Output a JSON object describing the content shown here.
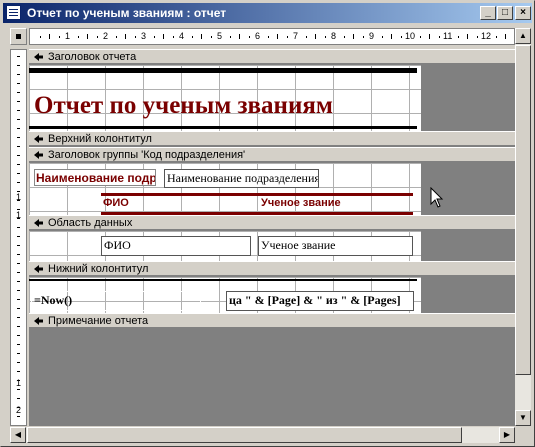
{
  "window": {
    "title": "Отчет по ученым званиям : отчет",
    "buttons": {
      "minimize": "_",
      "maximize": "□",
      "close": "×"
    }
  },
  "ruler": {
    "h_numbers": [
      "1",
      "2",
      "3",
      "4",
      "5",
      "6",
      "7",
      "8",
      "9",
      "10",
      "11",
      "12"
    ],
    "v_numbers": [
      "1",
      "1",
      "1",
      "2"
    ]
  },
  "sections": {
    "report_header": "Заголовок отчета",
    "page_header": "Верхний колонтитул",
    "group_header": "Заголовок группы 'Код подразделения'",
    "detail": "Область данных",
    "page_footer": "Нижний колонтитул",
    "report_footer": "Примечание отчета"
  },
  "controls": {
    "report_title": "Отчет по ученым званиям",
    "group_label": "Наименование подра",
    "group_field": "Наименование подразделения",
    "fio_label": "ФИО",
    "rank_label": "Ученое звание",
    "fio_field": "ФИО",
    "rank_field": "Ученое звание",
    "date_expr": "=Now()",
    "page_expr": "ца \" & [Page] & \" из \" & [Pages]"
  },
  "colors": {
    "title_bar": "#0a246a",
    "accent": "#7a0000",
    "workspace": "#808080"
  }
}
